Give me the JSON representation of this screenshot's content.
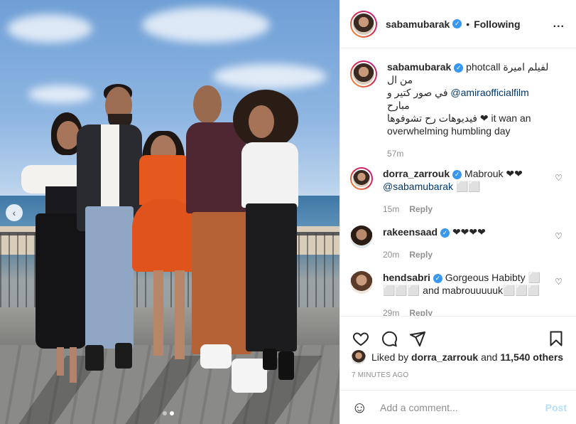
{
  "header": {
    "username": "sabamubarak",
    "separator": "•",
    "follow_status": "Following",
    "more": "..."
  },
  "caption": {
    "username": "sabamubarak",
    "text_before": "لفيلم اميرة photcall من ال",
    "text_line2_pre": "في صور كتير و",
    "mention": "@amiraofficialfilm",
    "text_line2_post": "مبارح",
    "text_line3": "فيديوهات رح تشوفوها ❤ it wan an overwhelming humbling day",
    "age": "57m"
  },
  "comments": [
    {
      "username": "dorra_zarrouk",
      "text": "Mabrouk ❤❤",
      "mention": "@sabamubarak",
      "extra": "⬜⬜",
      "age": "15m",
      "reply": "Reply"
    },
    {
      "username": "rakeensaad",
      "text": "❤❤❤❤",
      "age": "20m",
      "reply": "Reply"
    },
    {
      "username": "hendsabri",
      "text": "Gorgeous Habibty ⬜ ⬜⬜⬜ and mabrouuuuuk⬜⬜⬜",
      "age": "29m",
      "reply": "Reply"
    }
  ],
  "likes": {
    "prefix": "Liked by",
    "user": "dorra_zarrouk",
    "and": "and",
    "count": "11,540 others"
  },
  "timestamp": "7 MINUTES AGO",
  "add_comment": {
    "placeholder": "Add a comment...",
    "post_label": "Post"
  },
  "carousel": {
    "arrow": "‹",
    "total": 2,
    "active": 2
  }
}
